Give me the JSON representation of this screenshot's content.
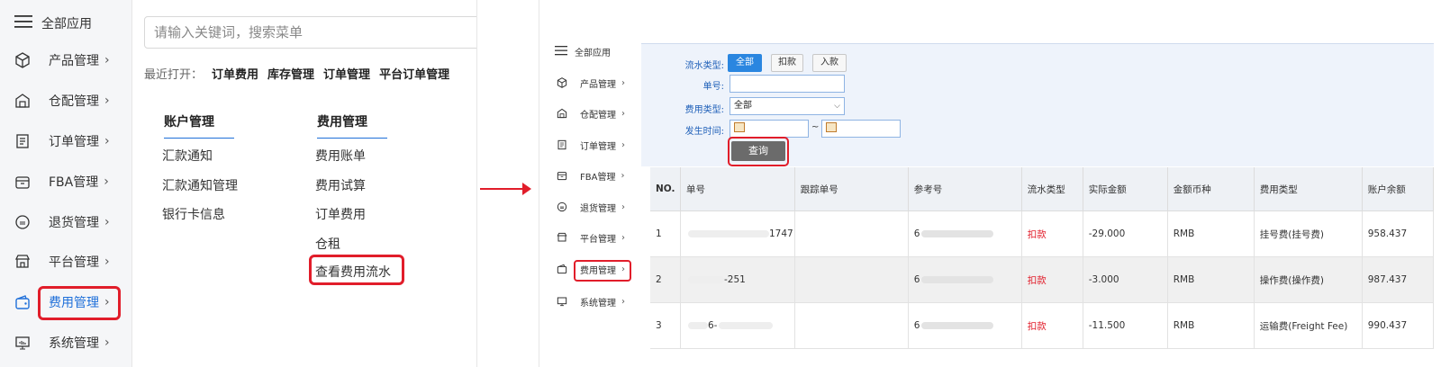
{
  "left": {
    "sidebar": {
      "all_apps": "全部应用",
      "items": [
        {
          "label": "产品管理",
          "icon": "cube-icon"
        },
        {
          "label": "仓配管理",
          "icon": "warehouse-icon"
        },
        {
          "label": "订单管理",
          "icon": "order-icon"
        },
        {
          "label": "FBA管理",
          "icon": "box-icon"
        },
        {
          "label": "退货管理",
          "icon": "return-icon"
        },
        {
          "label": "平台管理",
          "icon": "store-icon"
        },
        {
          "label": "费用管理",
          "icon": "wallet-icon",
          "active": true
        },
        {
          "label": "系统管理",
          "icon": "monitor-icon"
        }
      ],
      "chevron": "›"
    },
    "search_placeholder": "请输入关键词，搜索菜单",
    "recent": {
      "label": "最近打开：",
      "items": [
        "订单费用",
        "库存管理",
        "订单管理",
        "平台订单管理"
      ]
    },
    "columns": [
      {
        "title": "账户管理",
        "links": [
          "汇款通知",
          "汇款通知管理",
          "银行卡信息"
        ]
      },
      {
        "title": "费用管理",
        "links": [
          "费用账单",
          "费用试算",
          "订单费用",
          "仓租",
          "查看费用流水"
        ]
      }
    ]
  },
  "right": {
    "sidebar": {
      "all_apps": "全部应用",
      "items": [
        "产品管理",
        "仓配管理",
        "订单管理",
        "FBA管理",
        "退货管理",
        "平台管理",
        "费用管理",
        "系统管理"
      ]
    },
    "filter": {
      "flow_type_label": "流水类型:",
      "flow_buttons": [
        "全部",
        "扣款",
        "入款"
      ],
      "order_no_label": "单号:",
      "order_no_value": "",
      "fee_type_label": "费用类型:",
      "fee_type_value": "全部",
      "time_label": "发生时间:",
      "time_sep": "~",
      "query_label": "查询"
    },
    "table": {
      "headers": [
        "NO.",
        "单号",
        "跟踪单号",
        "参考号",
        "流水类型",
        "实际金额",
        "金额币种",
        "费用类型",
        "账户余额"
      ],
      "rows": [
        {
          "no": "1",
          "order": "1747",
          "track": "",
          "ref": "6",
          "flow": "扣款",
          "amount": "-29.000",
          "currency": "RMB",
          "fee": "挂号费(挂号费)",
          "balance": "958.437"
        },
        {
          "no": "2",
          "order": "-251",
          "track": "",
          "ref": "6",
          "flow": "扣款",
          "amount": "-3.000",
          "currency": "RMB",
          "fee": "操作费(操作费)",
          "balance": "987.437"
        },
        {
          "no": "3",
          "order": "6-",
          "track": "",
          "ref": "6",
          "flow": "扣款",
          "amount": "-11.500",
          "currency": "RMB",
          "fee": "运输费(Freight Fee)",
          "balance": "990.437"
        }
      ]
    }
  },
  "colors": {
    "accent": "#1e6fd9",
    "highlight": "#e11d2a",
    "button_active": "#2a86e0"
  }
}
